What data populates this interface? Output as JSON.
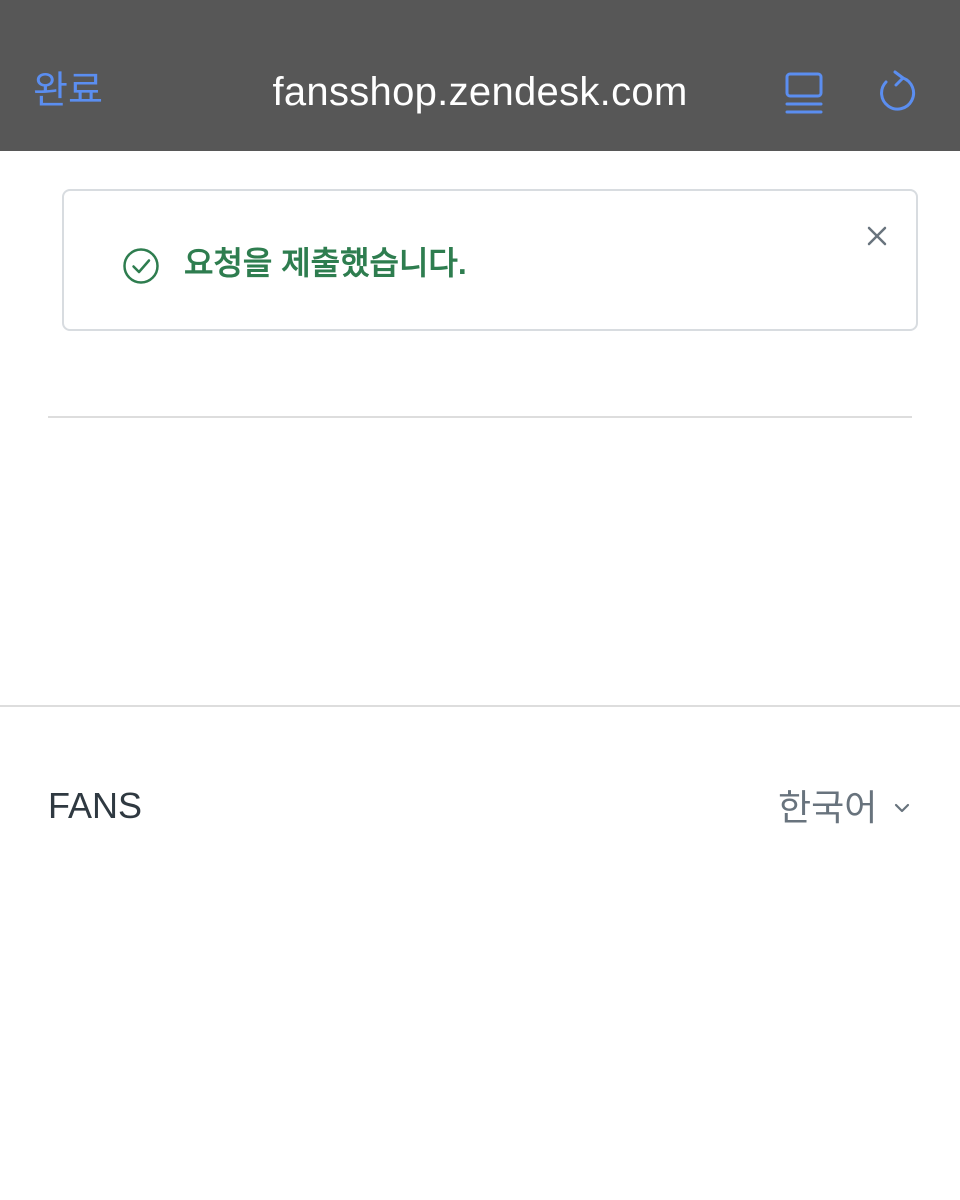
{
  "browser_bar": {
    "done_label": "완료",
    "url_title": "fansshop.zendesk.com",
    "reader_icon": "reader-view-icon",
    "reload_icon": "reload-icon",
    "accent_color": "#5b8ef0"
  },
  "notice": {
    "message": "요청을 제출했습니다.",
    "icon": "check-circle-icon",
    "close_icon": "close-icon",
    "text_color": "#2e7d4f"
  },
  "footer": {
    "brand": "FANS",
    "language": {
      "selected": "한국어",
      "icon": "chevron-down-icon"
    }
  }
}
